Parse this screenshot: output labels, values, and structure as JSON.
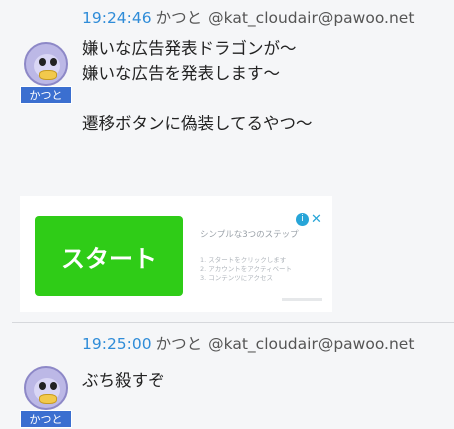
{
  "posts": [
    {
      "time": "19:24:46",
      "display_name": "かつと",
      "account": "@kat_cloudair@pawoo.net",
      "avatar_tag": "かつと",
      "lines": [
        "嫌いな広告発表ドラゴンが〜",
        "嫌いな広告を発表します〜",
        "",
        "遷移ボタンに偽装してるやつ〜"
      ],
      "ad": {
        "button_label": "スタート",
        "heading": "シンプルな3つのステップ",
        "steps": [
          "1. スタートをクリックします",
          "2. アカウントをアクティベート",
          "3. コンテンツにアクセス"
        ],
        "info_icon": "info-icon",
        "close_icon": "close-icon"
      }
    },
    {
      "time": "19:25:00",
      "display_name": "かつと",
      "account": "@kat_cloudair@pawoo.net",
      "avatar_tag": "かつと",
      "lines": [
        "ぶち殺すぞ"
      ]
    }
  ],
  "colors": {
    "time": "#2f8cd8",
    "ad_button": "#2fcc17",
    "avatar_tag": "#3b6fd0",
    "background": "#f5f6f8"
  }
}
